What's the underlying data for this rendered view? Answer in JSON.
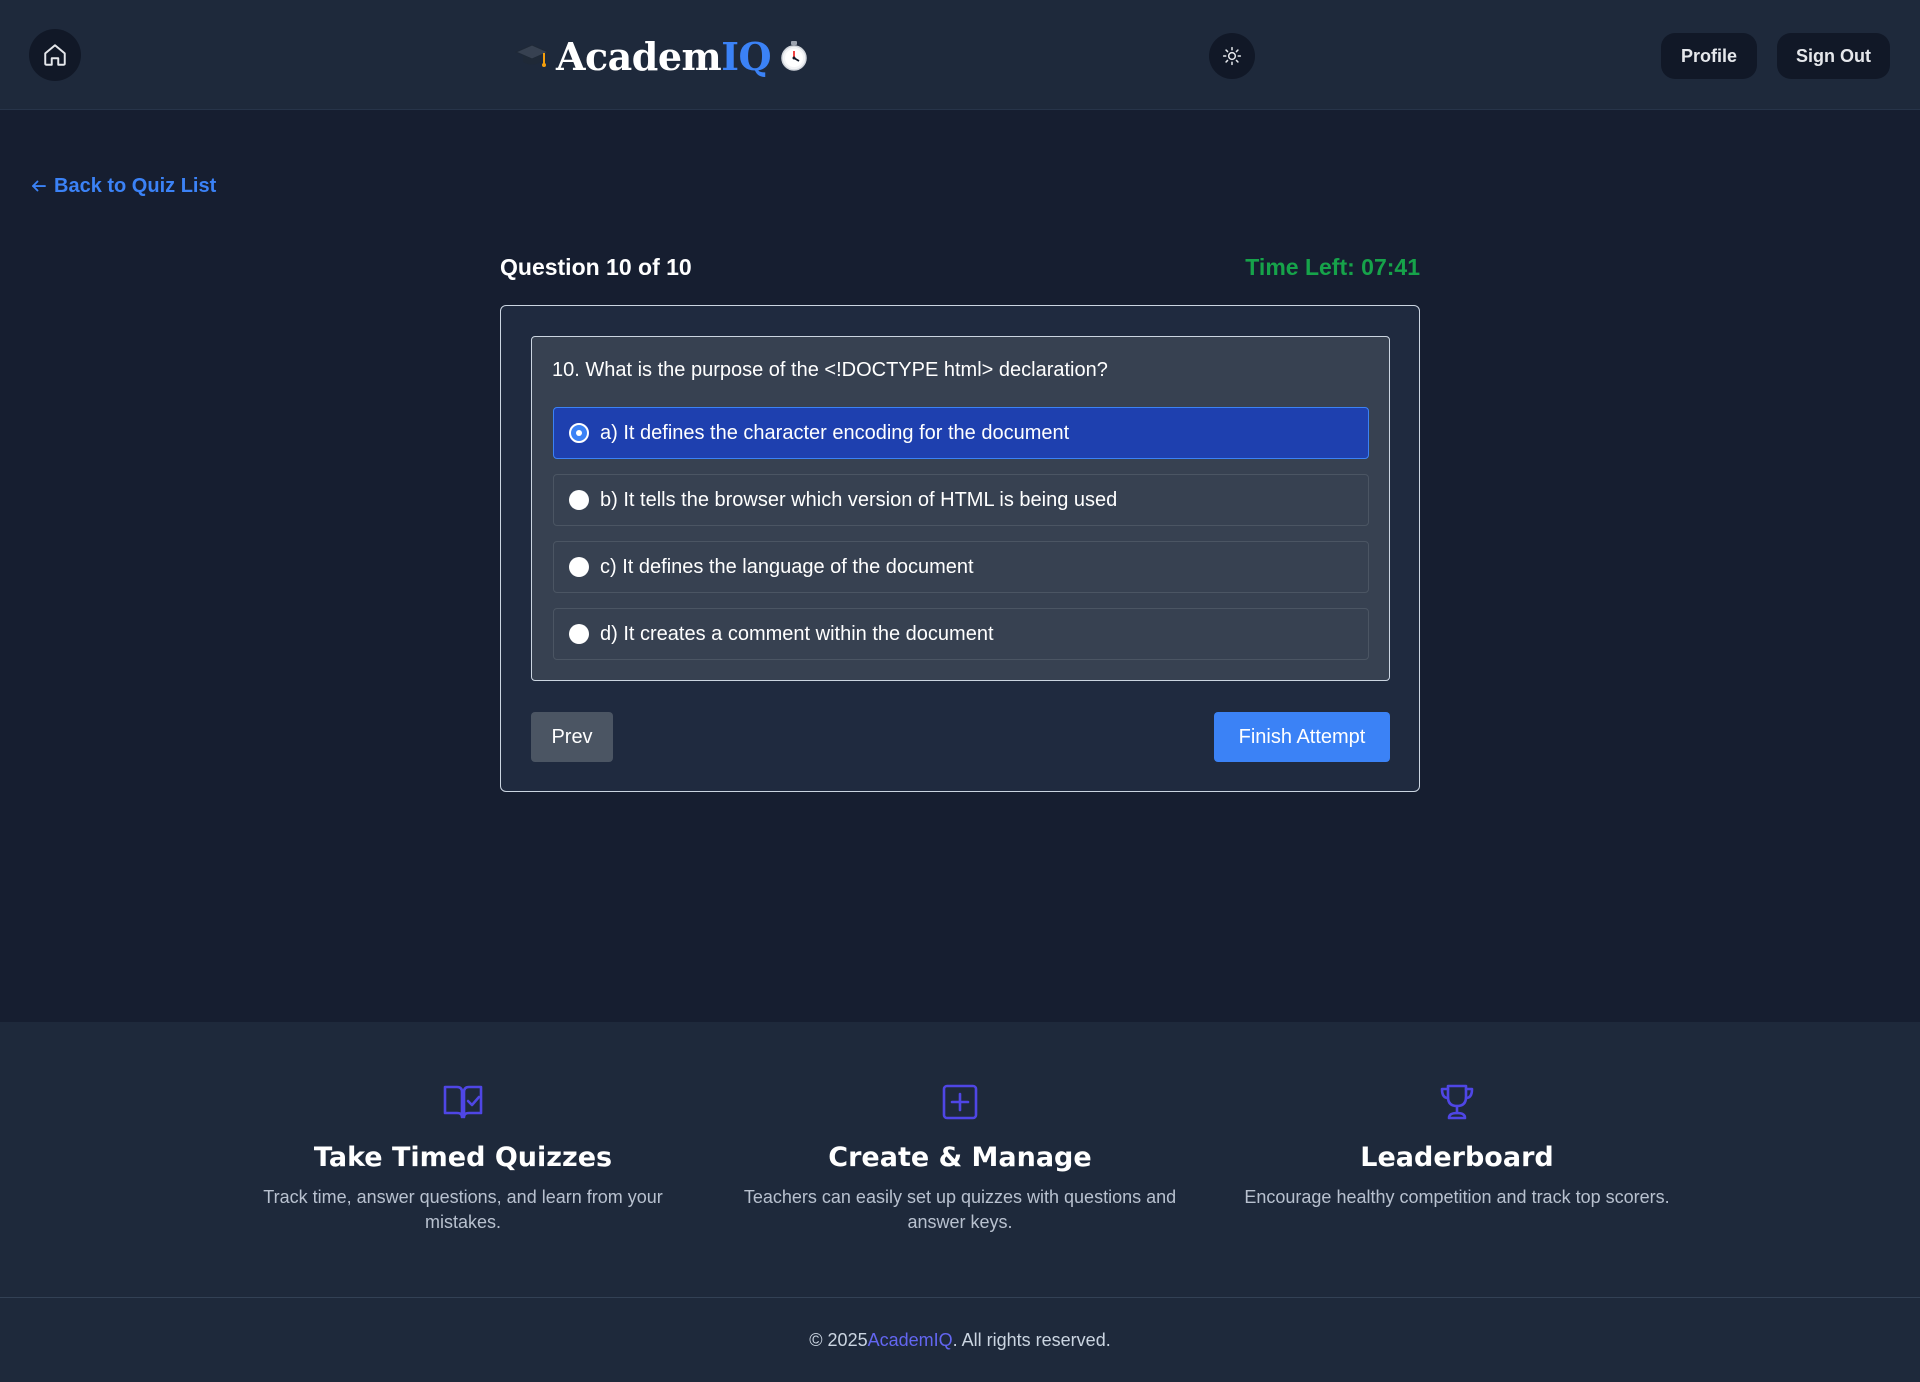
{
  "header": {
    "logo_part1": "Academ",
    "logo_part2": "IQ",
    "profile_label": "Profile",
    "signout_label": "Sign Out"
  },
  "nav": {
    "back_label": "Back to Quiz List"
  },
  "quiz": {
    "counter": "Question 10 of 10",
    "time_left_label": "Time Left:",
    "time_left_value": "07:41",
    "question": "10. What is the purpose of the <!DOCTYPE html> declaration?",
    "options": [
      {
        "label": "a) It defines the character encoding for the document",
        "selected": true
      },
      {
        "label": "b) It tells the browser which version of HTML is being used",
        "selected": false
      },
      {
        "label": "c) It defines the language of the document",
        "selected": false
      },
      {
        "label": "d) It creates a comment within the document",
        "selected": false
      }
    ],
    "prev_label": "Prev",
    "finish_label": "Finish Attempt"
  },
  "features": [
    {
      "icon": "book-check-icon",
      "title": "Take Timed Quizzes",
      "desc": "Track time, answer questions, and learn from your mistakes."
    },
    {
      "icon": "plus-square-icon",
      "title": "Create & Manage",
      "desc": "Teachers can easily set up quizzes with questions and answer keys."
    },
    {
      "icon": "trophy-icon",
      "title": "Leaderboard",
      "desc": "Encourage healthy competition and track top scorers."
    }
  ],
  "footer": {
    "copyright_prefix": "© 2025 ",
    "brand": "AcademIQ",
    "copyright_suffix": ". All rights reserved."
  },
  "colors": {
    "accent": "#3b82f6",
    "timer": "#16a34a",
    "feature_icon": "#4f46e5",
    "footer_brand": "#6366f1"
  }
}
